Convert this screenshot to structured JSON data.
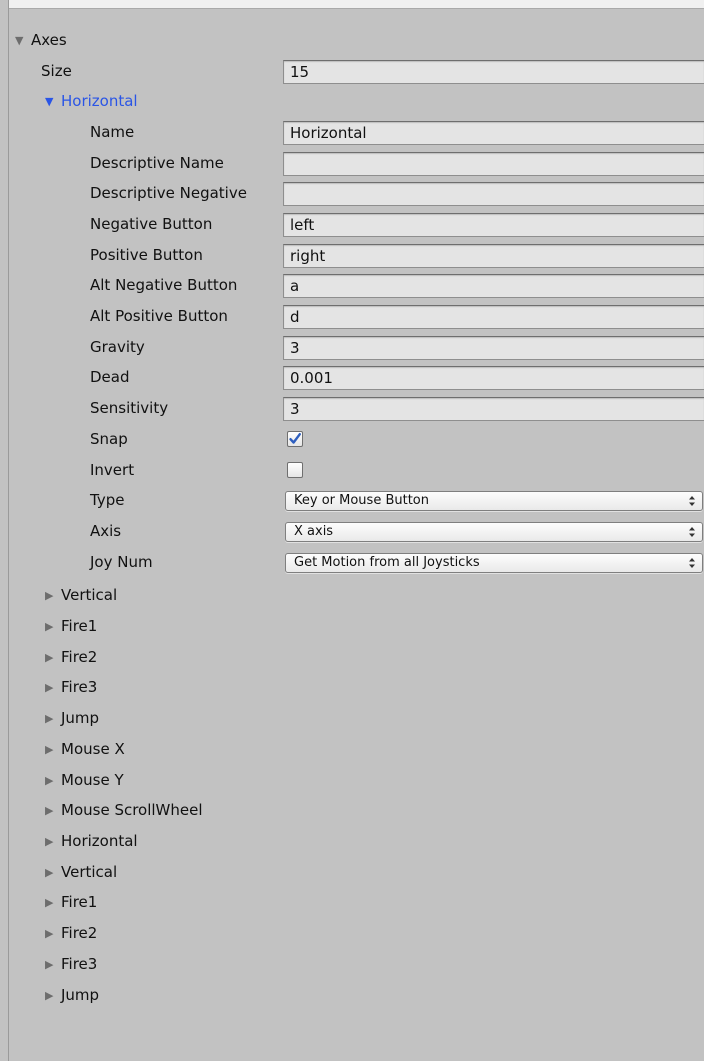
{
  "axes": {
    "title": "Axes",
    "size_label": "Size",
    "size_value": "15"
  },
  "expanded": {
    "title": "Horizontal",
    "fields": [
      {
        "label": "Name",
        "value": "Horizontal"
      },
      {
        "label": "Descriptive Name",
        "value": ""
      },
      {
        "label": "Descriptive Negative",
        "value": ""
      },
      {
        "label": "Negative Button",
        "value": "left"
      },
      {
        "label": "Positive Button",
        "value": "right"
      },
      {
        "label": "Alt Negative Button",
        "value": "a"
      },
      {
        "label": "Alt Positive Button",
        "value": "d"
      },
      {
        "label": "Gravity",
        "value": "3"
      },
      {
        "label": "Dead",
        "value": "0.001"
      },
      {
        "label": "Sensitivity",
        "value": "3"
      }
    ],
    "snap": {
      "label": "Snap",
      "checked": true
    },
    "invert": {
      "label": "Invert",
      "checked": false
    },
    "type": {
      "label": "Type",
      "value": "Key or Mouse Button"
    },
    "axis": {
      "label": "Axis",
      "value": "X axis"
    },
    "joy_num": {
      "label": "Joy Num",
      "value": "Get Motion from all Joysticks"
    }
  },
  "collapsed_axes": [
    "Vertical",
    "Fire1",
    "Fire2",
    "Fire3",
    "Jump",
    "Mouse X",
    "Mouse Y",
    "Mouse ScrollWheel",
    "Horizontal",
    "Vertical",
    "Fire1",
    "Fire2",
    "Fire3",
    "Jump"
  ],
  "colors": {
    "panel_background": "#c2c2c2",
    "field_background": "#e4e4e4",
    "selected_foldout": "#2a55e6",
    "checkmark": "#2f5fbf"
  },
  "icons": {
    "foldout_expanded": "triangle-down-icon",
    "foldout_collapsed": "triangle-right-icon",
    "checkmark": "checkmark-icon",
    "dropdown": "up-down-arrows-icon"
  }
}
